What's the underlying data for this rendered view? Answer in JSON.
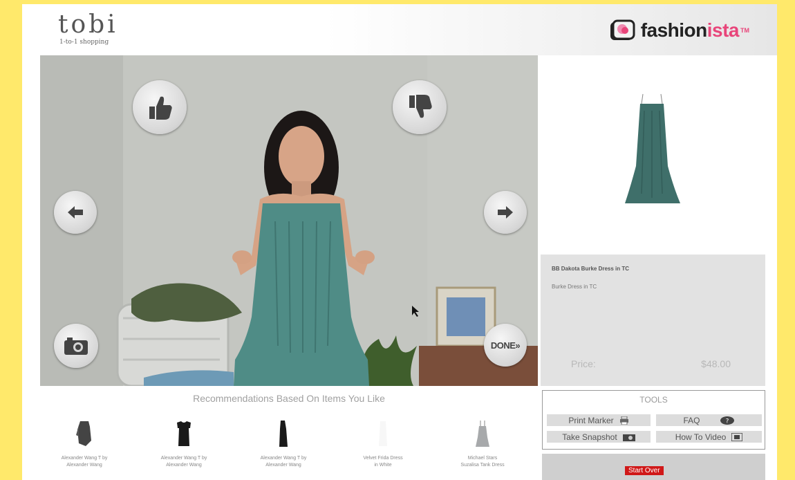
{
  "header": {
    "brand_left": "tobi",
    "brand_left_sub": "1-to-1 shopping",
    "brand_right_main": "fashion",
    "brand_right_accent": "ista",
    "brand_right_tm": "TM"
  },
  "video_controls": {
    "done_label": "DONE»"
  },
  "product": {
    "title": "BB Dakota Burke Dress in TC",
    "subtitle": "Burke Dress in TC",
    "price_label": "Price:",
    "price_value": "$48.00",
    "dress_color": "#3f6f6a"
  },
  "tools": {
    "title": "TOOLS",
    "print_marker": "Print Marker",
    "faq": "FAQ",
    "take_snapshot": "Take Snapshot",
    "how_to_video": "How To Video"
  },
  "start_over": "Start Over",
  "recommendations": {
    "title": "Recommendations Based On Items You Like",
    "items": [
      {
        "line1": "Alexander Wang T by",
        "line2": "Alexander Wang"
      },
      {
        "line1": "Alexander Wang T by",
        "line2": "Alexander Wang"
      },
      {
        "line1": "Alexander Wang T by",
        "line2": "Alexander Wang"
      },
      {
        "line1": "Velvet Frida Dress",
        "line2": "in White"
      },
      {
        "line1": "Michael Stars",
        "line2": "Suzalisa Tank Dress"
      }
    ]
  },
  "colors": {
    "background_yellow": "#ffe96b",
    "accent_pink": "#e8457a",
    "start_over_red": "#d01818"
  }
}
